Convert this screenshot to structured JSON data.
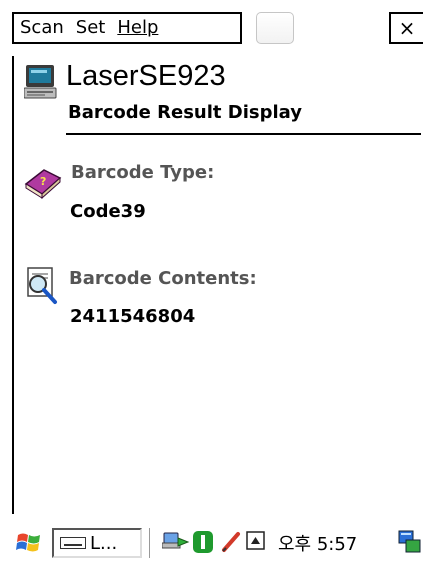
{
  "menubar": {
    "items": [
      {
        "label": "Scan"
      },
      {
        "label": "Set"
      },
      {
        "label": "Help"
      }
    ],
    "close_label": "×"
  },
  "header": {
    "app_name": "LaserSE923",
    "subtitle": "Barcode Result Display"
  },
  "result": {
    "type_label": "Barcode Type:",
    "type_value": "Code39",
    "contents_label": "Barcode Contents:",
    "contents_value": "2411546804"
  },
  "taskbar": {
    "task_label": "L...",
    "clock": "오후 5:57"
  },
  "icons": {
    "device": "computer-device-icon",
    "type": "help-book-icon",
    "contents": "magnifier-document-icon",
    "start": "windows-flag-icon",
    "network": "network-connection-icon",
    "battery": "battery-status-icon",
    "pen": "input-pen-icon",
    "sip": "input-panel-arrow-icon",
    "tray_app": "tray-app-icon"
  }
}
